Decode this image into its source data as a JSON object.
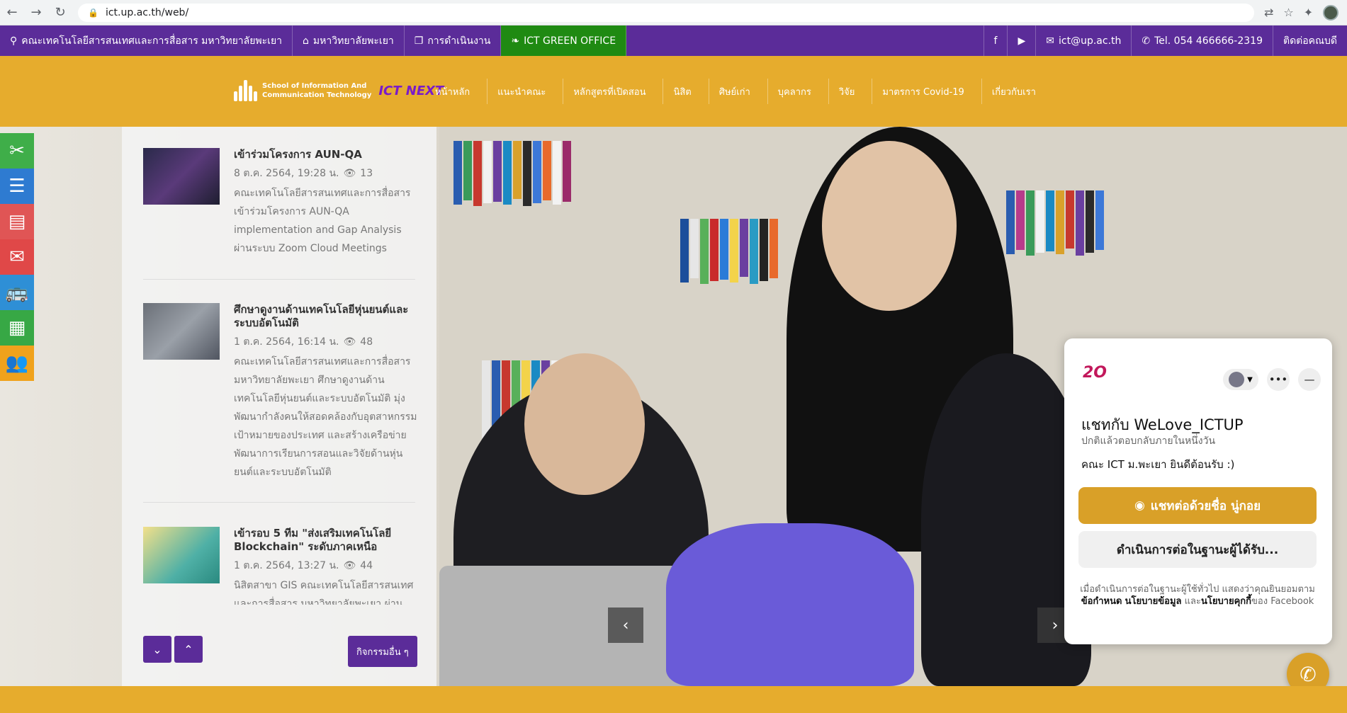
{
  "browser": {
    "url": "ict.up.ac.th/web/"
  },
  "topbar": {
    "location": "คณะเทคโนโลยีสารสนเทศและการสื่อสาร มหาวิทยาลัยพะเยา",
    "university": "มหาวิทยาลัยพะเยา",
    "operations": "การดำเนินงาน",
    "green_office": "ICT GREEN OFFICE",
    "email": "ict@up.ac.th",
    "tel": "Tel. 054 466666-2319",
    "contact": "ติดต่อคณบดี"
  },
  "header": {
    "logo_line1": "School of Information And",
    "logo_line2": "Communication Technology",
    "logo_next": "ICT NEXT",
    "menu": [
      "หน้าหลัก",
      "แนะนำคณะ",
      "หลักสูตรที่เปิดสอน",
      "นิสิต",
      "ศิษย์เก่า",
      "บุคลากร",
      "วิจัย",
      "มาตรการ Covid-19",
      "เกี่ยวกับเรา"
    ]
  },
  "side_icons": [
    "scissors-icon",
    "list-icon",
    "document-icon",
    "mail-icon",
    "bus-icon",
    "calendar-icon",
    "users-icon"
  ],
  "news": {
    "items": [
      {
        "title": "เข้าร่วมโครงการ AUN-QA",
        "date": "8 ต.ค. 2564, 19:28 น.",
        "views": "13",
        "desc": "คณะเทคโนโลยีสารสนเทศและการสื่อสาร เข้าร่วมโครงการ AUN-QA implementation and Gap Analysis ผ่านระบบ Zoom Cloud Meetings"
      },
      {
        "title": "ศึกษาดูงานด้านเทคโนโลยีหุ่นยนต์และระบบอัตโนมัติ",
        "date": "1 ต.ค. 2564, 16:14 น.",
        "views": "48",
        "desc": "คณะเทคโนโลยีสารสนเทศและการสื่อสาร มหาวิทยาลัยพะเยา ศึกษาดูงานด้านเทคโนโลยีหุ่นยนต์และระบบอัตโนมัติ มุ่งพัฒนากำลังคนให้สอดคล้องกับอุตสาหกรรมเป้าหมายของประเทศ และสร้างเครือข่ายพัฒนาการเรียนการสอนและวิจัยด้านหุ่นยนต์และระบบอัตโนมัติ"
      },
      {
        "title": "เข้ารอบ 5 ทีม \"ส่งเสริมเทคโนโลยี Blockchain\" ระดับภาคเหนือ",
        "date": "1 ต.ค. 2564, 13:27 น.",
        "views": "44",
        "desc": "นิสิตสาขา GIS คณะเทคโนโลยีสารสนเทศและการสื่อสาร มหาวิทยาลัยพะเยา ผ่าน"
      }
    ],
    "more_label": "กิจกรรมอื่น ๆ"
  },
  "chat": {
    "title": "แชทกับ WeLove_ICTUP",
    "subtitle": "ปกติแล้วตอบกลับภายในหนึ่งวัน",
    "greeting": "คณะ ICT ม.พะเยา ยินดีต้อนรับ :)",
    "continue_label": "แชทต่อด้วยชื่อ นู่กอย",
    "guest_label": "ดำเนินการต่อในฐานะผู้ได้รับ...",
    "note_1": "เมื่อดำเนินการต่อในฐานะผู้ใช้ทั่วไป แสดงว่าคุณยินยอมตาม",
    "note_terms": "ข้อกำหนด",
    "note_policy": "นโยบายข้อมูล",
    "note_and": "และ",
    "note_cookie": "นโยบายคุกกี้",
    "note_2": "ของ Facebook"
  },
  "colors": {
    "purple": "#5b2c99",
    "gold": "#e6ac2d",
    "green": "#1f8a12"
  }
}
